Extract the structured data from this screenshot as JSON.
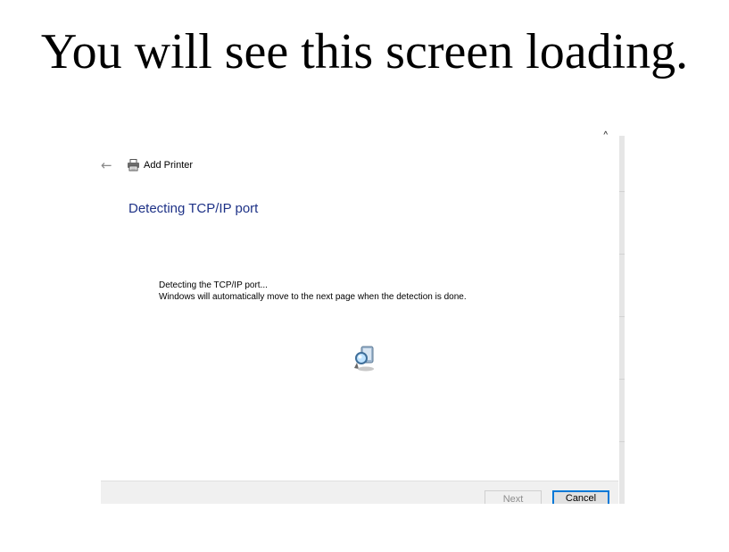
{
  "slide": {
    "title": "You will see this screen loading."
  },
  "window": {
    "back_icon": "back-arrow-icon",
    "printer_icon": "printer-icon",
    "title": "Add Printer",
    "scroll_up_icon": "chevron-up-icon"
  },
  "main": {
    "heading": "Detecting TCP/IP port",
    "line1": "Detecting the TCP/IP port...",
    "line2": "Windows will automatically move to the next page when the detection is done.",
    "animation_icon": "search-animation-icon"
  },
  "buttons": {
    "next_label": "Next",
    "cancel_label": "Cancel"
  },
  "colors": {
    "heading": "#1e3287",
    "focus_border": "#0078d7",
    "button_bar": "#f0f0f0"
  }
}
